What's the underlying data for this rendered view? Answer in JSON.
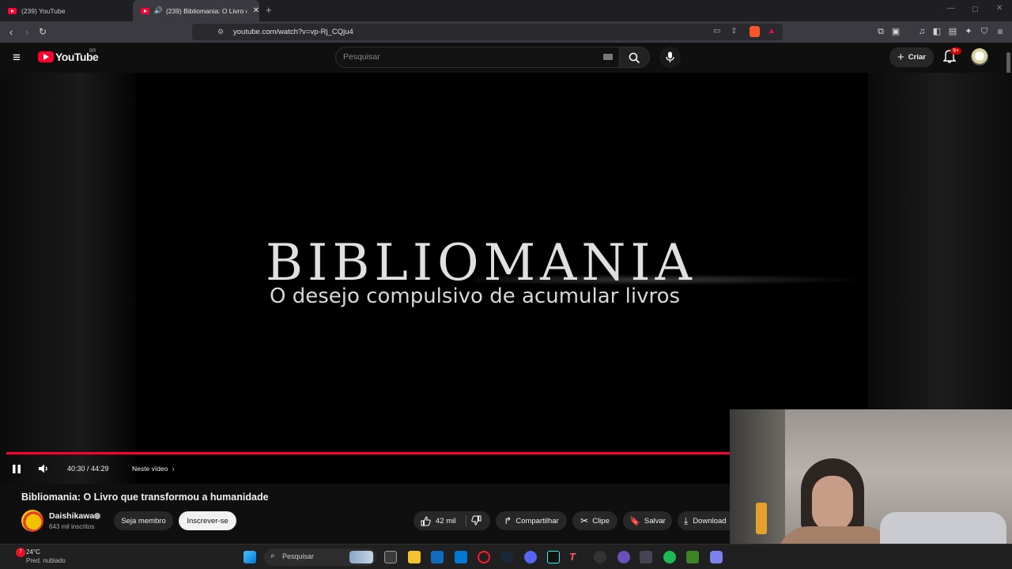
{
  "tabs": [
    {
      "title": "(239) YouTube",
      "active": false
    },
    {
      "title": "(239) Bibliomania: O Livro qu",
      "active": true
    }
  ],
  "address": {
    "url": "youtube.com/watch?v=vp-Rj_CQju4"
  },
  "youtube": {
    "logo_text": "YouTube",
    "region": "BR",
    "search_placeholder": "Pesquisar",
    "create_label": "Criar",
    "notifications_badge": "9+"
  },
  "video": {
    "frame_title": "BIBLIOMANIA",
    "frame_subtitle": "O desejo compulsivo de acumular livros",
    "time": "40:30 / 44:29",
    "chapters_label": "Neste vídeo",
    "progress_fraction": 0.91
  },
  "info": {
    "title": "Bibliomania: O Livro que transformou a humanidade",
    "channel_name": "Daishikawa",
    "subscribers": "643 mil inscritos",
    "join_label": "Seja membro",
    "subscribe_label": "Inscrever-se",
    "likes": "42 mil",
    "share_label": "Compartilhar",
    "clip_label": "Clipe",
    "save_label": "Salvar",
    "download_label": "Download"
  },
  "taskbar": {
    "weather_temp": "24°C",
    "weather_desc": "Pred. nublado",
    "weather_badge": "7",
    "search_placeholder": "Pesquisar"
  },
  "colors": {
    "accent": "#ff0033",
    "background": "#0f0f0f"
  }
}
